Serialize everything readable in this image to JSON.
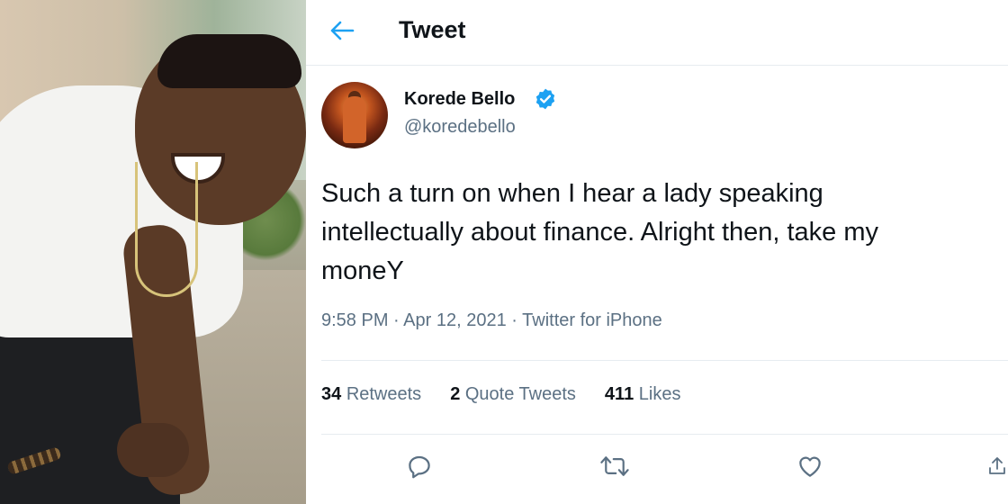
{
  "header": {
    "title": "Tweet",
    "back_icon": "arrow-left-icon"
  },
  "author": {
    "display_name": "Korede Bello",
    "handle": "@koredebello",
    "verified_icon": "verified-badge-icon"
  },
  "tweet": {
    "lines": [
      "Such a turn on when I hear a lady speaking",
      "intellectually about finance. Alright then, take my",
      "moneY"
    ],
    "time": "9:58 PM",
    "date": "Apr 12, 2021",
    "source": "Twitter for iPhone",
    "separator": "·"
  },
  "stats": {
    "retweets_count": "34",
    "retweets_label": "Retweets",
    "quotes_count": "2",
    "quotes_label": "Quote Tweets",
    "likes_count": "411",
    "likes_label": "Likes"
  },
  "actions": [
    "reply-icon",
    "retweet-icon",
    "like-icon",
    "share-icon"
  ],
  "colors": {
    "accent": "#1da1f2",
    "text": "#0f1419",
    "muted": "#5b7083",
    "border": "#e6ecf0"
  }
}
